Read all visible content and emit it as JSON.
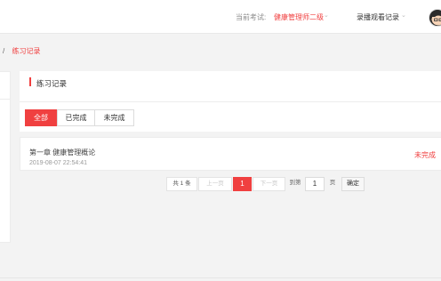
{
  "header": {
    "exam_label": "当前考试:",
    "exam_value": "健康管理师二级",
    "record_watch": "录播观看记录"
  },
  "breadcrumb": {
    "separator": "/",
    "current": "练习记录"
  },
  "section": {
    "title": "练习记录"
  },
  "tabs": [
    {
      "label": "全部",
      "active": true
    },
    {
      "label": "已完成",
      "active": false
    },
    {
      "label": "未完成",
      "active": false
    }
  ],
  "records": [
    {
      "title": "第一章 健康管理概论",
      "date": "2019-08-07 22:54:41",
      "status": "未完成"
    }
  ],
  "pagination": {
    "total": "共 1 条",
    "prev": "上一页",
    "current_page": "1",
    "next": "下一页",
    "goto_label": "到第",
    "goto_value": "1",
    "page_unit": "页",
    "confirm": "确定"
  },
  "colors": {
    "accent": "#f04040",
    "background": "#f3f3f3"
  },
  "icons": {
    "chevron": "chevron-down-icon",
    "avatar": "user-avatar"
  }
}
